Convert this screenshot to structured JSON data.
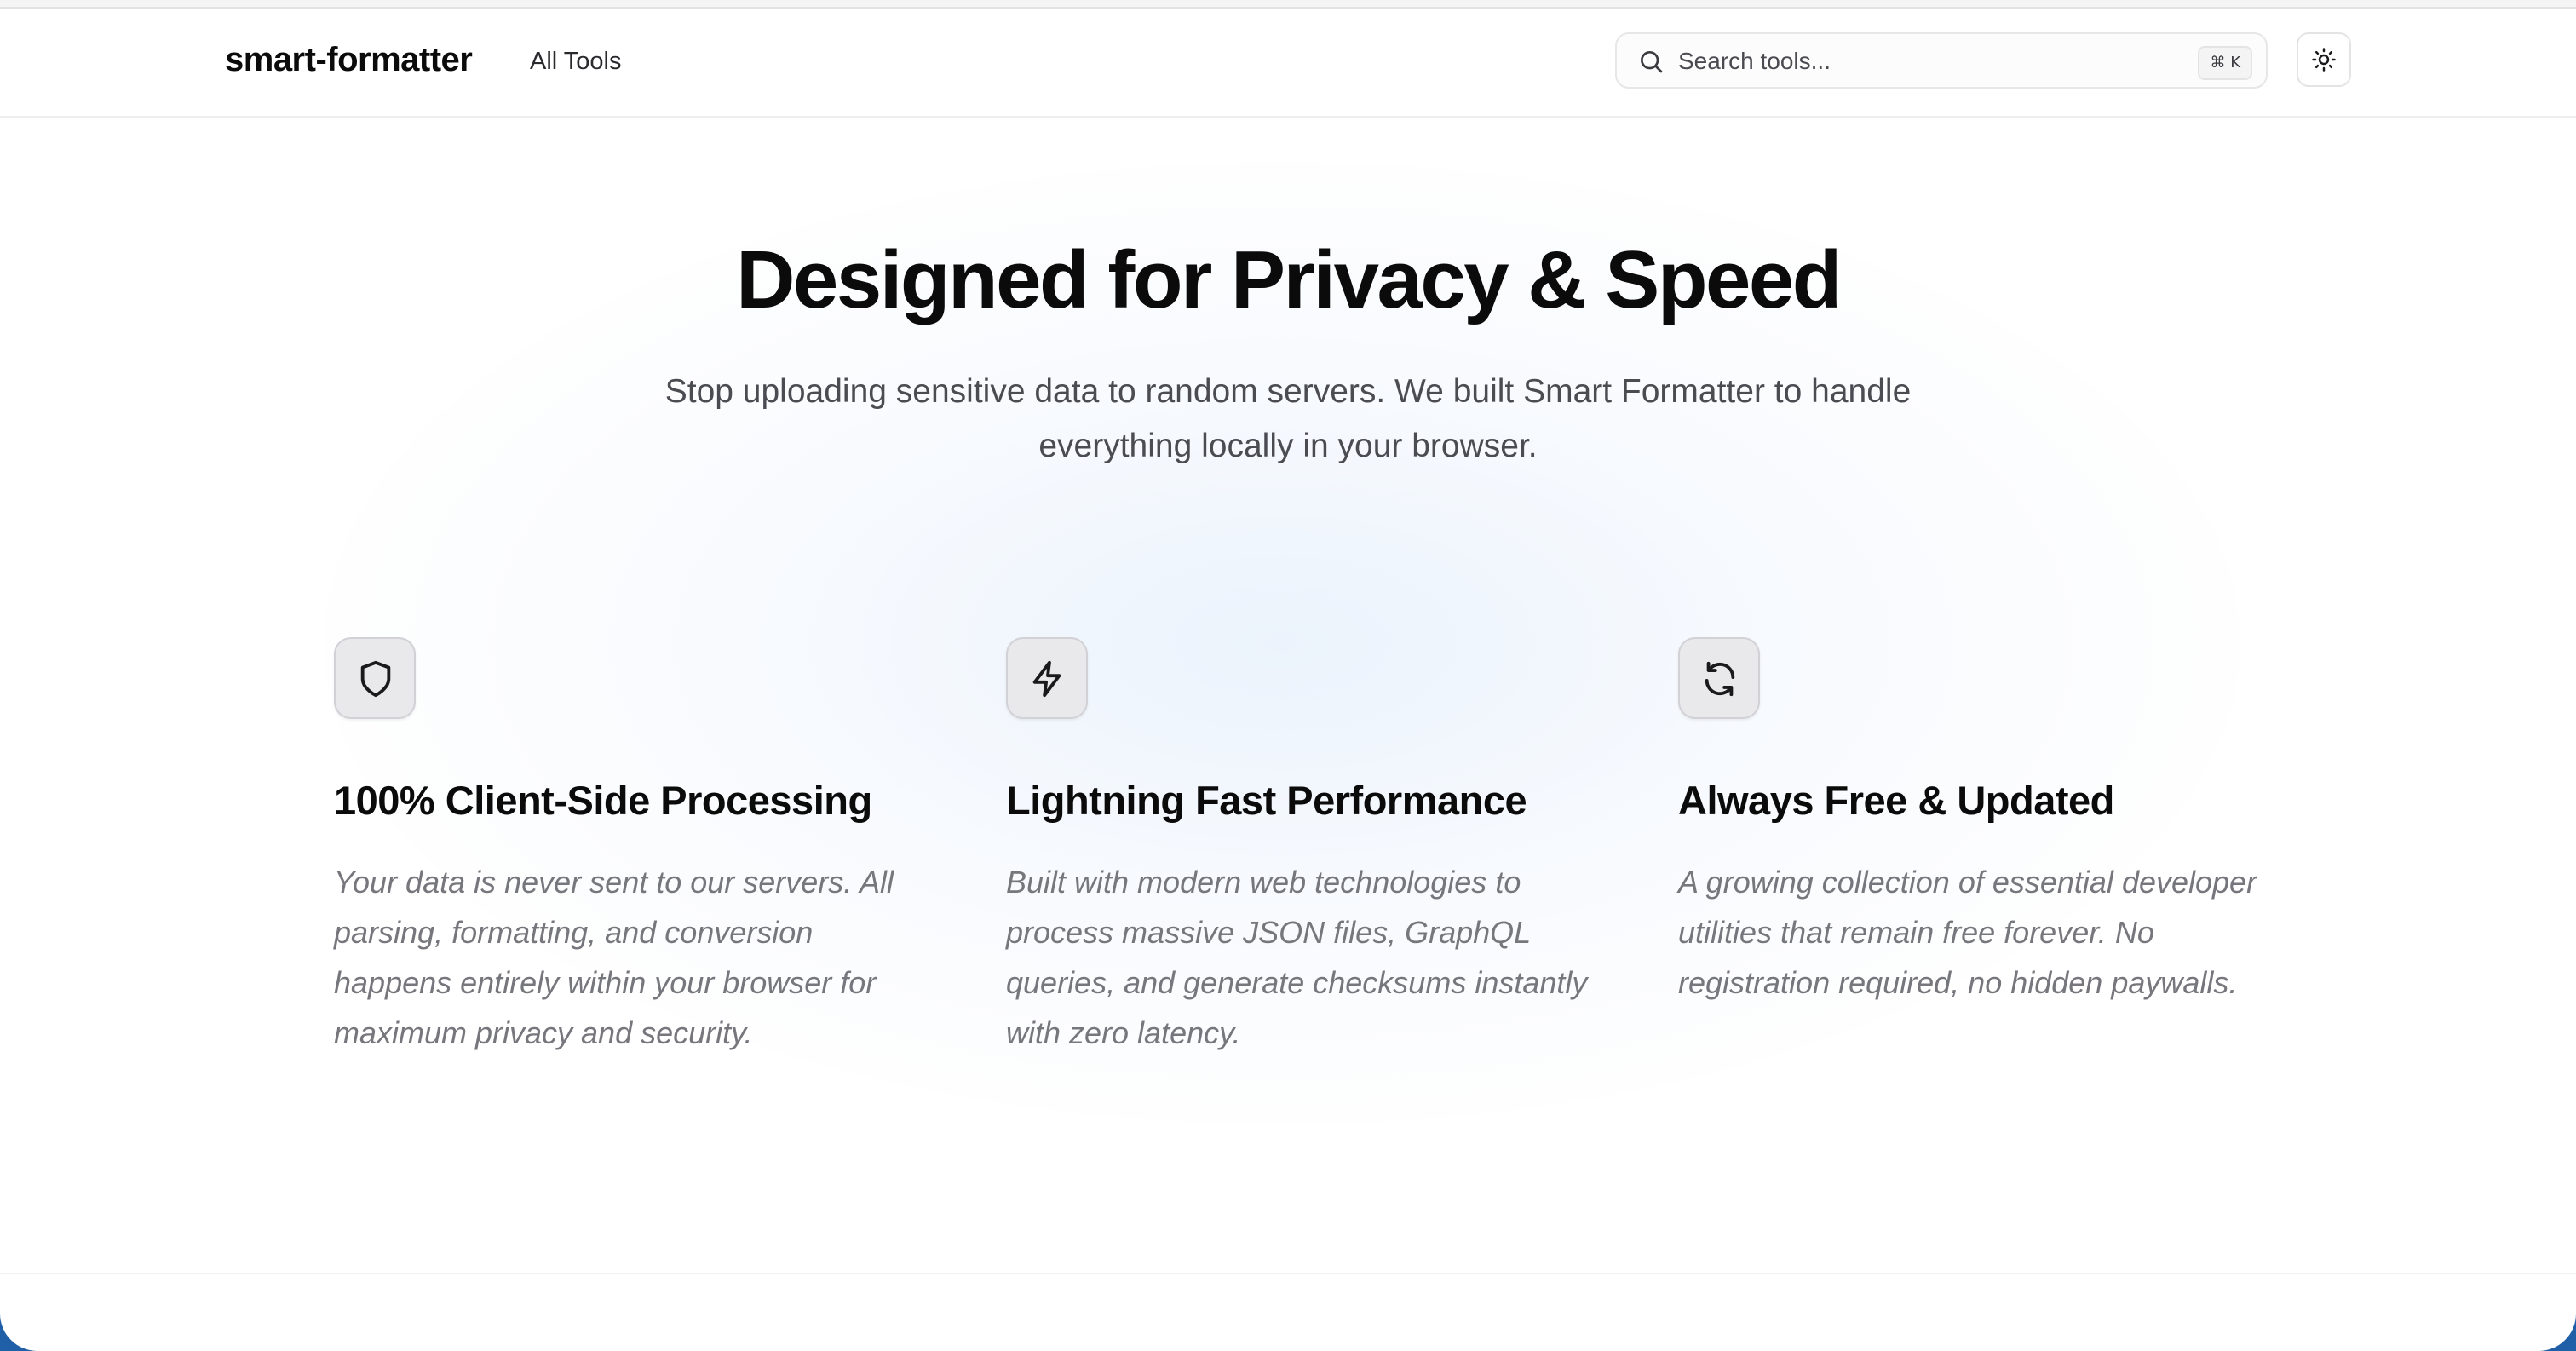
{
  "header": {
    "brand": "smart-formatter",
    "nav_all_tools": "All Tools",
    "search": {
      "placeholder": "Search tools...",
      "shortcut": "⌘ K",
      "icon": "search-icon"
    },
    "theme_toggle_icon": "sun-icon"
  },
  "hero": {
    "title": "Designed for Privacy & Speed",
    "subtitle": "Stop uploading sensitive data to random servers. We built Smart Formatter to handle everything locally in your browser."
  },
  "features": [
    {
      "icon": "shield-icon",
      "title": "100% Client-Side Processing",
      "description": "Your data is never sent to our servers. All parsing, formatting, and conversion happens entirely within your browser for maximum privacy and security."
    },
    {
      "icon": "lightning-icon",
      "title": "Lightning Fast Performance",
      "description": "Built with modern web technologies to process massive JSON files, GraphQL queries, and generate checksums instantly with zero latency."
    },
    {
      "icon": "refresh-icon",
      "title": "Always Free & Updated",
      "description": "A growing collection of essential developer utilities that remain free forever. No registration required, no hidden paywalls."
    }
  ],
  "colors": {
    "text_primary": "#0b0b0c",
    "text_secondary": "#4b4b52",
    "text_muted": "#76767d",
    "icon_box_bg": "#e9e9ec",
    "desktop_blue": "#1f5fa8"
  }
}
